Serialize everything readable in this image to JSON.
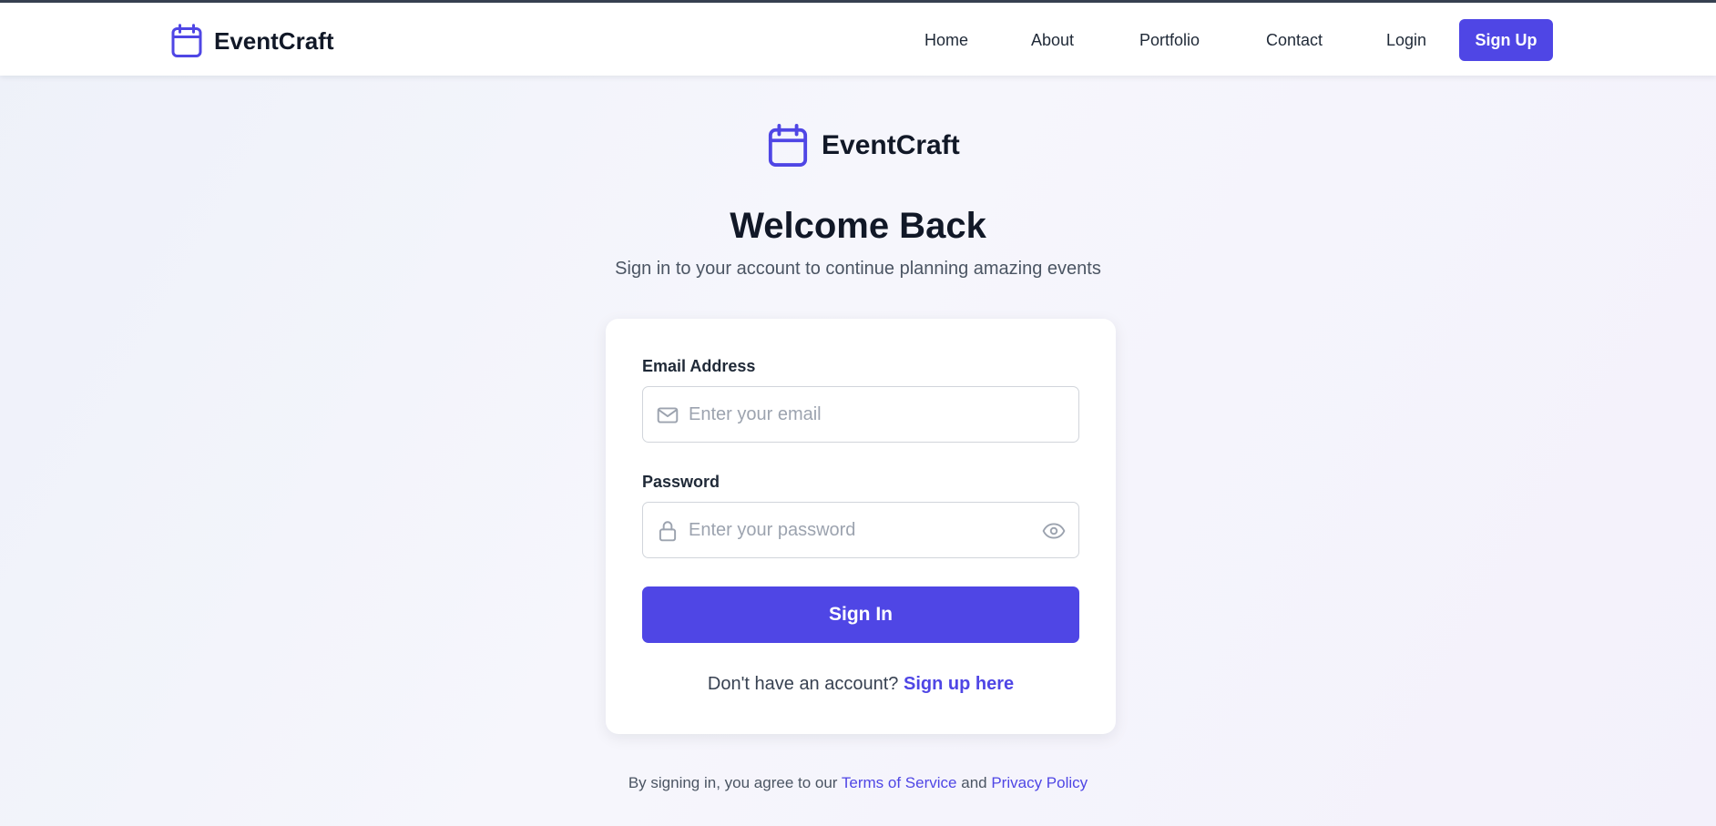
{
  "brand": {
    "name": "EventCraft",
    "icon": "calendar-icon",
    "accent": "#4f46e5"
  },
  "nav": {
    "items": [
      {
        "label": "Home"
      },
      {
        "label": "About"
      },
      {
        "label": "Portfolio"
      },
      {
        "label": "Contact"
      },
      {
        "label": "Login"
      }
    ],
    "signup_label": "Sign Up"
  },
  "hero": {
    "title": "Welcome Back",
    "subtitle": "Sign in to your account to continue planning amazing events"
  },
  "form": {
    "email": {
      "label": "Email Address",
      "placeholder": "Enter your email",
      "value": "",
      "icon": "mail-icon"
    },
    "password": {
      "label": "Password",
      "placeholder": "Enter your password",
      "value": "",
      "icon": "lock-icon",
      "toggle_icon": "eye-icon"
    },
    "submit_label": "Sign In",
    "signup_prompt": "Don't have an account?",
    "signup_link": "Sign up here"
  },
  "legal": {
    "prefix": "By signing in, you agree to our",
    "terms": "Terms of Service",
    "and": "and",
    "privacy": "Privacy Policy"
  }
}
